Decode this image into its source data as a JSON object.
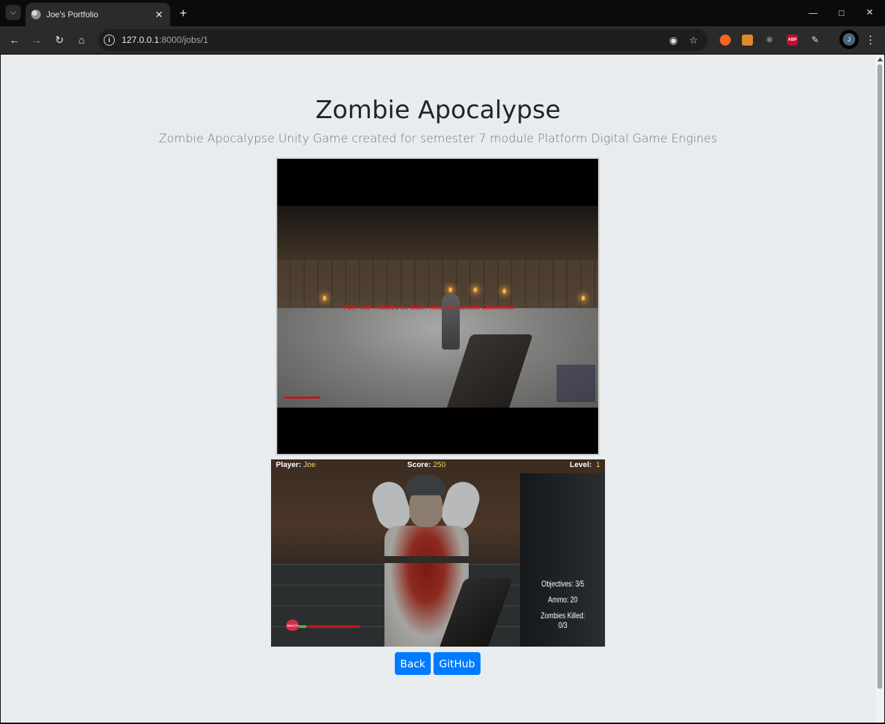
{
  "browser": {
    "tab_title": "Joe's Portfolio",
    "url_host": "127.0.0.1",
    "url_path": ":8000/jobs/1",
    "profile_initial": "J",
    "ext_abp_label": "ABP"
  },
  "page": {
    "title": "Zombie Apocalypse",
    "subtitle": "Zombie Apocalypse Unity Game created for semester 7 module Platform Digital Game Engines",
    "screenshot1": {
      "fun_fact": "Fun Fact: I Wasted So Much Time On Random Comments"
    },
    "screenshot2": {
      "player_label": "Player:",
      "player_value": "Joe",
      "score_label": "Score:",
      "score_value": "250",
      "level_label": "Level:",
      "level_value": "1",
      "objectives": "Objectives: 3/5",
      "ammo": "Ammo: 20",
      "zombies_killed": "Zombies Killed: 0/3",
      "health_icon_label": "HEALTH",
      "health_fraction": 0.12
    },
    "buttons": {
      "back": "Back",
      "github": "GitHub"
    }
  },
  "colors": {
    "primary": "#007bff",
    "page_background": "#e9ecef",
    "title": "#212529",
    "subtitle": "#6c757d"
  }
}
